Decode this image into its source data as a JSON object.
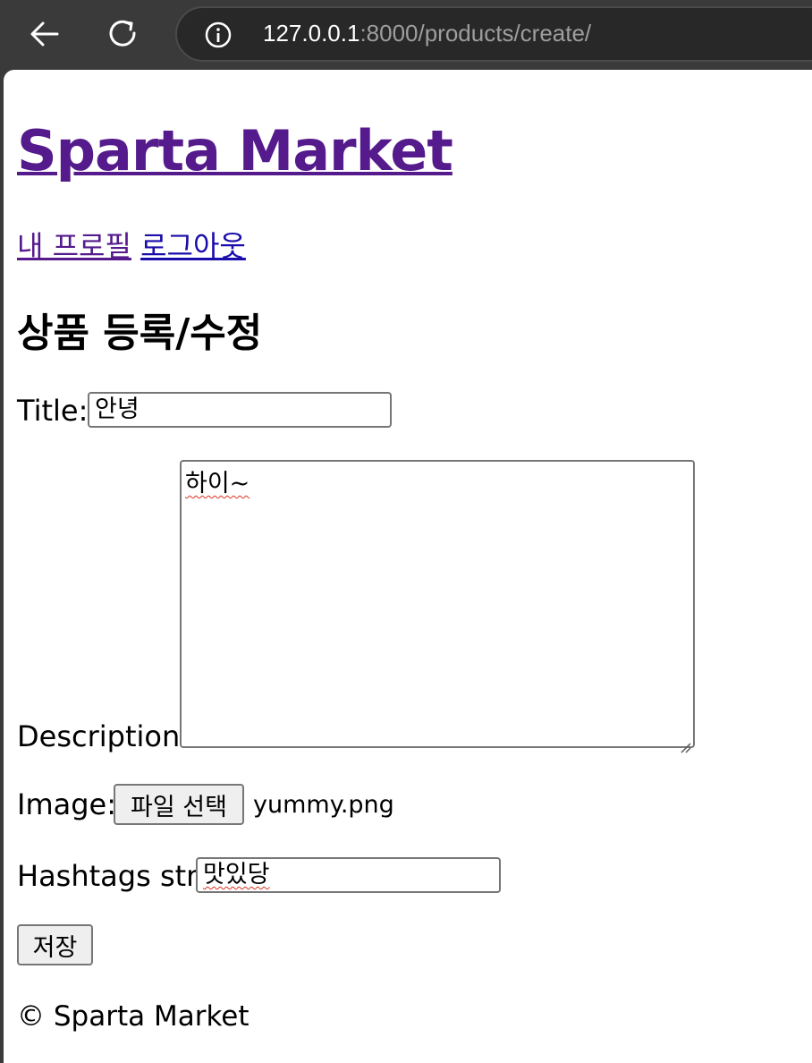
{
  "browser": {
    "url_host": "127.0.0.1",
    "url_rest": ":8000/products/create/"
  },
  "header": {
    "site_title": "Sparta Market",
    "nav": [
      {
        "label": "내 프로필"
      },
      {
        "label": "로그아웃"
      }
    ]
  },
  "form": {
    "heading": "상품 등록/수정",
    "title_label": "Title:",
    "title_value": "안녕",
    "description_label": "Description:",
    "description_value": "하이~",
    "image_label": "Image:",
    "file_button_label": "파일 선택",
    "file_name": "yummy.png",
    "hashtags_label": "Hashtags str:",
    "hashtags_value": "맛있당",
    "save_label": "저장"
  },
  "footer": {
    "text": "© Sparta Market"
  },
  "colors": {
    "link": "#1a0dab",
    "visited_link": "#551a8b",
    "spellcheck": "#d93025"
  }
}
